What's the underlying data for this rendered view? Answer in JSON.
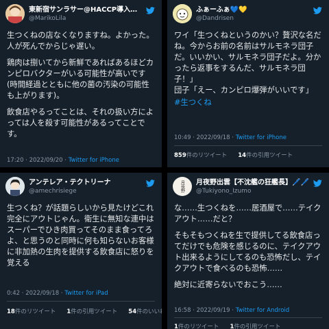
{
  "tweets": [
    {
      "name": "東新宿サンラサー@HACCP導入コンサルタ…",
      "handle": "@MarikoLila",
      "paragraphs": [
        "生つくねの店なくなりますね。よかった。人が死んでからじゃ遅い。",
        "鶏肉は捌いてから新鮮であればあるほどカンピロバクターがいる可能性が高いです(時間経過とともに他の菌の汚染の可能性も上がります)。",
        "飲食店やるってことは、それの扱い方によっては人を殺す可能性があるってことです。"
      ],
      "time": "17:20 · 2022/09/20 · ",
      "source": "Twitter for iPhone"
    },
    {
      "name": "ふぁーふぁ💙💛",
      "handle": "@Dandrisen",
      "paragraphs": [
        "ワイ「生つくねというのかい？贅沢な名だね。今からお前の名前はサルモネラ団子だ。いいかい、サルモネラ団子だよ。分かったら返事をするんだ、サルモネラ団子！」\n団子「えー、カンピロ爆弾がいいです」"
      ],
      "hashtag": "#生つくね",
      "time": "10:49 · 2022/09/18 · ",
      "source": "Twitter for iPhone",
      "retweets_num": "859",
      "retweets_label": "件のリツイート",
      "quotes_num": "14",
      "quotes_label": "件の引用ツイート"
    },
    {
      "name": "アンテレア・テクトリーナ",
      "handle": "@amechrisiege",
      "paragraphs": [
        "生つくね？が話題らしいから見たけどこれ完全にアウトじゃん。衛生に無知な連中はスーパーでひき肉買ってそのまま食ってろよ、と思うのと同時に何も知らないお客様に非加熱の生肉を提供する飲食店に怒りを覚える"
      ],
      "time": "0:42 · 2022/09/18 · ",
      "source": "Twitter for iPad",
      "retweets_num": "18",
      "retweets_label": "件のリツイート",
      "quotes_num": "1",
      "quotes_label": "件の引用ツイート",
      "likes_num": "54",
      "likes_label": "件のいいね"
    },
    {
      "name": "月夜野出雲【不沈艦の狂艦長】🖊️🖊️",
      "handle": "@Tukiyono_Izumo",
      "avatar_text": "月夜野",
      "paragraphs": [
        "な……生つくねを……居酒屋で……テイクアウト……だと？",
        "そもそもつくねを生で提供してる飲食店ってだけでも危険を感じるのに、テイクアウト出来るようにしてるのも恐怖だし、テイクアウトで食べるのも恐怖……",
        "絶対に近寄らないでおこう……"
      ],
      "time": "16:58 · 2022/09/19 · ",
      "source": "Twitter for Android",
      "retweets_num": "1",
      "retweets_label": "件のリツイート",
      "quotes_num": "1",
      "quotes_label": "件の引用ツイート"
    }
  ],
  "colors": {
    "background": "#15202b",
    "link": "#1d9bf0",
    "muted": "#8b98a5"
  }
}
